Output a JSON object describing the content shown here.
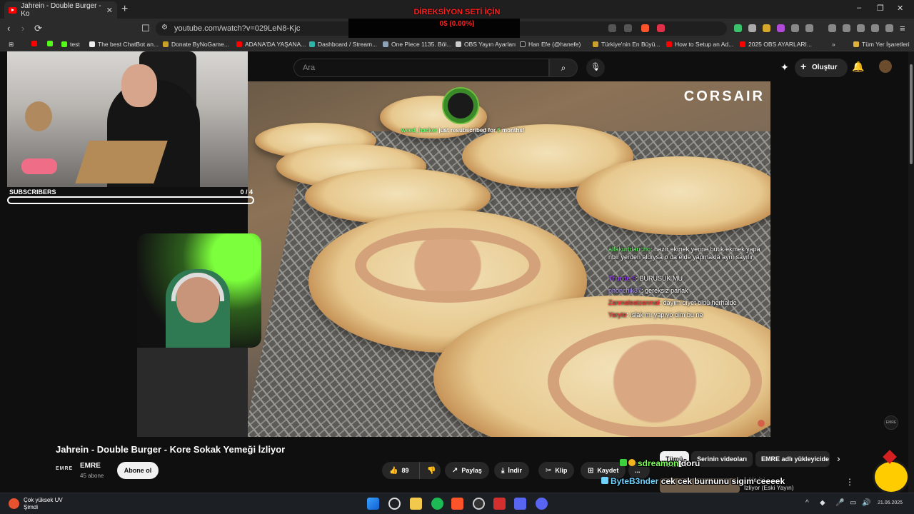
{
  "browser": {
    "tab_title": "Jahrein - Double Burger - Ko",
    "tab_close": "✕",
    "new_tab": "+",
    "url": "youtube.com/watch?v=029LeN8-Kjc",
    "window_controls": [
      "–",
      "❐",
      "✕"
    ],
    "bookmarks": [
      {
        "label": "",
        "color": "#ff0000"
      },
      {
        "label": "",
        "color": "#53fc18"
      },
      {
        "label": "test",
        "color": "#53fc18"
      },
      {
        "label": "The best ChatBot an...",
        "color": "#eeeeee"
      },
      {
        "label": "Donate ByNoGame...",
        "color": "#c9a227"
      },
      {
        "label": "ADANA'DA YAŞANA...",
        "color": "#ff0000"
      },
      {
        "label": "Dashboard / Stream...",
        "color": "#2fb5a8"
      },
      {
        "label": "One Piece 1135. Böl...",
        "color": "#8fa3b8"
      },
      {
        "label": "OBS Yayın Ayarları",
        "color": "#cccccc"
      },
      {
        "label": "Han Efe (@hanefe)",
        "color": "#222222"
      },
      {
        "label": "Türkiye'nin En Büyü...",
        "color": "#c9a227"
      },
      {
        "label": "How to Setup an Ad...",
        "color": "#ff0000"
      },
      {
        "label": "2025 OBS AYARLARI...",
        "color": "#ff0000"
      }
    ],
    "bookmarks_more": "»",
    "all_bookmarks": "Tüm Yer İşaretleri"
  },
  "overlay_top": {
    "line1": "DİREKSİYON SETİ İÇİN",
    "line2": "0$ (0.00%)"
  },
  "youtube": {
    "search_placeholder": "Ara",
    "create_label": "Oluştur",
    "video_title": "Jahrein - Double Burger - Kore Sokak Yemeği İzliyor",
    "channel_logo": "EMRE",
    "channel_name": "EMRE",
    "channel_subs": "45 abone",
    "subscribe_label": "Abone ol",
    "likes": "89",
    "share_label": "Paylaş",
    "download_label": "İndir",
    "clip_label": "Klip",
    "save_label": "Kaydet",
    "more_label": "...",
    "chips": [
      "Tümü",
      "Serinin videoları",
      "EMRE adlı yükleyicide"
    ],
    "chips_next": "›",
    "related_text_line1": "...klerini",
    "related_text_line2": "İzliyor (Eski Yayın)",
    "related_menu": "⋮"
  },
  "video_overlay": {
    "sponsor": "CORSAIR",
    "sub_alert_user": "weed_hacker",
    "sub_alert_text": " just resubscribed for ",
    "sub_alert_months": "6",
    "sub_alert_suffix": " months!",
    "chat": [
      {
        "user": "alfakurtdancho",
        "user_color": "#6aff6a",
        "text": "hazır ekmek yerine butik ekmek yapa nbir yerden aldıysa o da elde yapmakla aynı sayılır"
      },
      {
        "user": "Thunder9",
        "user_color": "#a24bff",
        "text": "BURUSUK MU"
      },
      {
        "user": "phonchik37",
        "user_color": "#b59cff",
        "text": "gereksiz parlak"
      },
      {
        "user": "Zanmaleatzanmal",
        "user_color": "#ff3b3b",
        "text": "dayım diyet öldü herhalde"
      },
      {
        "user": "Yaryte",
        "user_color": "#ff3b3b",
        "text": "ıslak mı yapıyo olm bu ne"
      }
    ],
    "chat_overlay": [
      {
        "user": "sdreamon",
        "text": "doru",
        "user_color": "#7dff5a"
      },
      {
        "user": "ByteB3nder",
        "text": "cek cek burnunu sigim ceeeek",
        "user_color": "#6fd3ff"
      }
    ]
  },
  "stream": {
    "subscribers_label": "SUBSCRIBERS",
    "subscribers_current": "0",
    "subscribers_goal": "4",
    "subscribers_count_text": "0 / 4",
    "subscribers_progress": 0
  },
  "taskbar": {
    "weather_line1": "Çok yüksek UV",
    "weather_line2": "Şimdi",
    "clock": "21.06.2025"
  }
}
